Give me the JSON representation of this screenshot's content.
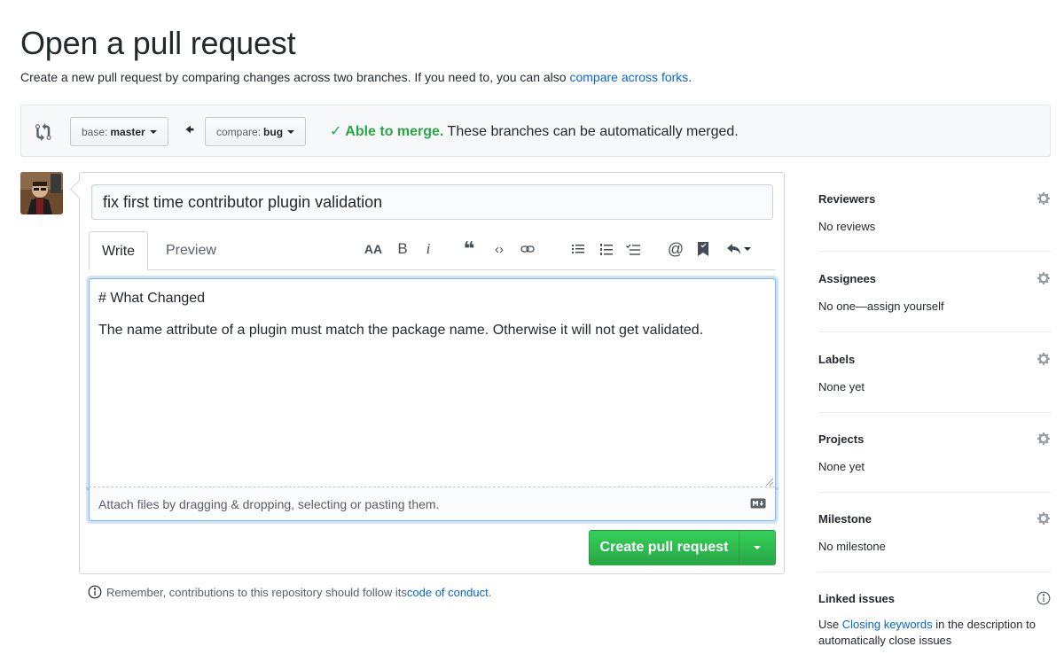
{
  "header": {
    "title": "Open a pull request",
    "subtitle_prefix": "Create a new pull request by comparing changes across two branches. If you need to, you can also ",
    "subtitle_link": "compare across forks",
    "subtitle_suffix": "."
  },
  "range": {
    "base_prefix": "base:",
    "base_branch": "master",
    "compare_prefix": "compare:",
    "compare_branch": "bug",
    "merge_ok": "✓ Able to merge.",
    "merge_text": " These branches can be automatically merged."
  },
  "composer": {
    "title_value": "fix first time contributor plugin validation",
    "tabs": {
      "write": "Write",
      "preview": "Preview"
    },
    "toolbar": {
      "header": "AA",
      "bold": "B",
      "italic": "i",
      "quote": "❝",
      "code": "‹›",
      "link": "link-icon",
      "ul": "unordered-list-icon",
      "ol": "ordered-list-icon",
      "tasklist": "task-list-icon",
      "mention": "@",
      "bookmark": "bookmark-icon",
      "reply": "reply-icon"
    },
    "body": "# What Changed\n\nThe name attribute of a plugin must match the package name. Otherwise it will not get validated.",
    "attach_text": "Attach files by dragging & dropping, selecting or pasting them.",
    "submit_label": "Create pull request"
  },
  "conduct": {
    "prefix": "Remember, contributions to this repository should follow its ",
    "link": "code of conduct",
    "suffix": "."
  },
  "sidebar": {
    "reviewers": {
      "title": "Reviewers",
      "value": "No reviews"
    },
    "assignees": {
      "title": "Assignees",
      "value": "No one—assign yourself"
    },
    "labels": {
      "title": "Labels",
      "value": "None yet"
    },
    "projects": {
      "title": "Projects",
      "value": "None yet"
    },
    "milestone": {
      "title": "Milestone",
      "value": "No milestone"
    },
    "linked": {
      "title": "Linked issues",
      "value_prefix": "Use ",
      "value_link": "Closing keywords",
      "value_suffix": " in the description to automatically close issues"
    }
  },
  "colors": {
    "link": "#0366d6",
    "success": "#28a745",
    "button_green": "#2ea44f",
    "focus": "#79b8ff"
  }
}
